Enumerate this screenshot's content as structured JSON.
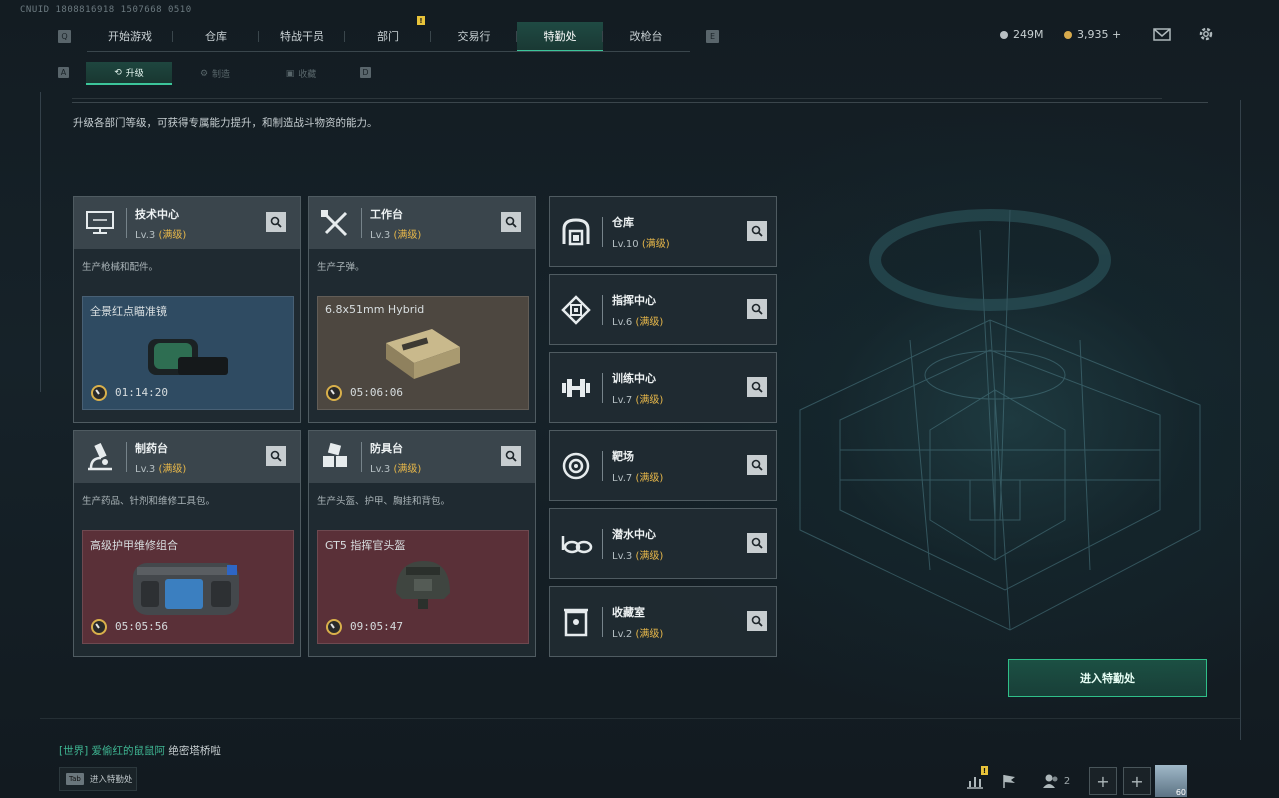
{
  "uid": "CNUID 1808816918 1507668 0510",
  "top_nav": {
    "left_key": "Q",
    "right_key": "E",
    "tabs": [
      {
        "label": "开始游戏",
        "active": false
      },
      {
        "label": "仓库",
        "active": false
      },
      {
        "label": "特战干员",
        "active": false
      },
      {
        "label": "部门",
        "active": false,
        "badge": "!"
      },
      {
        "label": "交易行",
        "active": false
      },
      {
        "label": "特勤处",
        "active": true
      },
      {
        "label": "改枪台",
        "active": false
      }
    ]
  },
  "sub_nav": {
    "left_key": "A",
    "right_key": "D",
    "tabs": [
      {
        "label": "升级",
        "active": true
      },
      {
        "label": "制造",
        "active": false
      },
      {
        "label": "收藏",
        "active": false
      }
    ]
  },
  "currency": {
    "silver": "249M",
    "gold": "3,935 +"
  },
  "description": "升级各部门等级，可获得专属能力提升，和制造战斗物资的能力。",
  "level_max_tag": "(满级)",
  "workshops": [
    {
      "name": "技术中心",
      "level": "Lv.3",
      "icon": "monitor-icon",
      "desc": "生产枪械和配件。",
      "product": "全景红点瞄准镜",
      "timer": "01:14:20",
      "bg": "#2f4b62"
    },
    {
      "name": "工作台",
      "level": "Lv.3",
      "icon": "tools-icon",
      "desc": "生产子弹。",
      "product": "6.8x51mm Hybrid",
      "timer": "05:06:06",
      "bg": "#4d4740"
    },
    {
      "name": "制药台",
      "level": "Lv.3",
      "icon": "microscope-icon",
      "desc": "生产药品、针剂和维修工具包。",
      "product": "高级护甲维修组合",
      "timer": "05:05:56",
      "bg": "#5a3038"
    },
    {
      "name": "防具台",
      "level": "Lv.3",
      "icon": "blocks-icon",
      "desc": "生产头盔、护甲、胸挂和背包。",
      "product": "GT5 指挥官头盔",
      "timer": "09:05:47",
      "bg": "#5a3038"
    }
  ],
  "facilities": [
    {
      "name": "仓库",
      "level": "Lv.10",
      "icon": "warehouse-icon"
    },
    {
      "name": "指挥中心",
      "level": "Lv.6",
      "icon": "chip-icon"
    },
    {
      "name": "训练中心",
      "level": "Lv.7",
      "icon": "dumbbell-icon"
    },
    {
      "name": "靶场",
      "level": "Lv.7",
      "icon": "target-icon"
    },
    {
      "name": "潜水中心",
      "level": "Lv.3",
      "icon": "diving-mask-icon"
    },
    {
      "name": "收藏室",
      "level": "Lv.2",
      "icon": "cabinet-icon"
    }
  ],
  "enter_button": "进入特勤处",
  "chat": {
    "channel": "[世界]",
    "user": "爱偷红的鼠鼠阿",
    "message": "绝密塔桥啦"
  },
  "tab_hint": {
    "key": "Tab",
    "label": "进入特勤处"
  },
  "bottom_bar": {
    "friends_count": "2",
    "avatar_level": "60"
  },
  "colors": {
    "accent": "#3cc59a",
    "max_level": "#e8b84a"
  }
}
